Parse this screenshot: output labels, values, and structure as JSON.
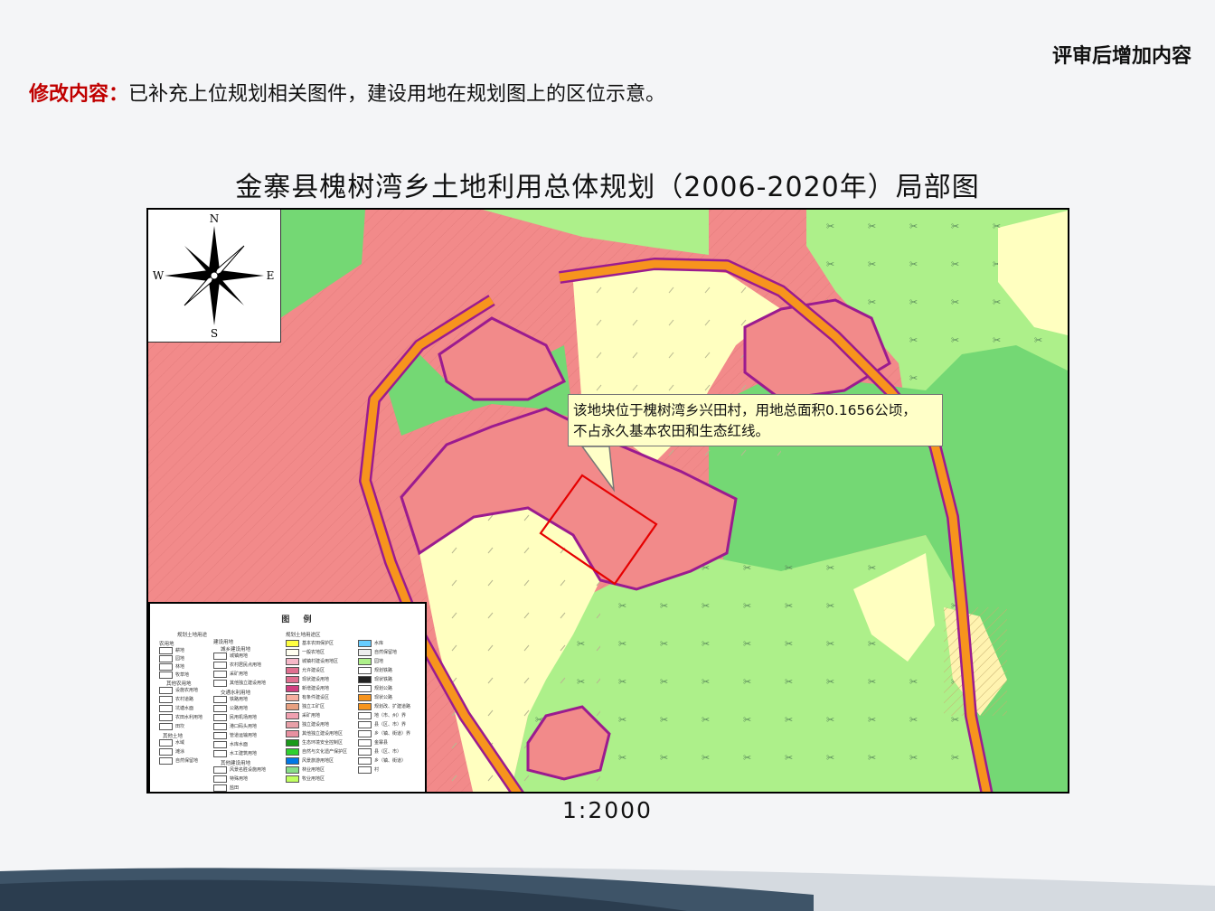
{
  "header": {
    "tag": "评审后增加内容",
    "note_label": "修改内容：",
    "note_text": "已补充上位规划相关图件，建设用地在规划图上的区位示意。"
  },
  "map": {
    "title": "金寨县槐树湾乡土地利用总体规划（2006-2020年）局部图",
    "scale": "1:2000",
    "callout_line1": "该地块位于槐树湾乡兴田村，用地总面积0.1656公顷，",
    "callout_line2": "不占永久基本农田和生态红线。",
    "compass": {
      "n": "N",
      "s": "S",
      "e": "E",
      "w": "W"
    },
    "colors": {
      "construction": "#f28a8a",
      "forest": "#74d874",
      "garden": "#adf08a",
      "farmland": "#ffffc0",
      "road": "#f7941d",
      "boundary": "#9b1b8f",
      "site": "#e60000"
    }
  },
  "legend": {
    "title": "图 例",
    "col1_header": "规划土地用途",
    "col1_sub1": "农用地",
    "col1_items": [
      "耕地",
      "园地",
      "林地",
      "牧草地"
    ],
    "col1_sub2": "其他农用地",
    "col1_items2": [
      "设施农用地",
      "农村道路",
      "坑塘水面",
      "农田水利用地",
      "田坎"
    ],
    "col1_sub3": "其他土地",
    "col1_items3": [
      "水域",
      "滩涂",
      "自然保留地"
    ],
    "col2_sub1": "建设用地",
    "col2_sub1b": "城乡建设用地",
    "col2_items": [
      "城镇用地",
      "农村居民点用地",
      "采矿用地",
      "其他独立建设用地"
    ],
    "col2_sub2": "交通水利用地",
    "col2_items2": [
      "铁路用地",
      "公路用地",
      "民用机场用地",
      "港口码头用地",
      "管道运输用地",
      "水库水面",
      "水工建筑用地"
    ],
    "col2_sub3": "其他建设用地",
    "col2_items3": [
      "风景名胜设施用地",
      "特殊用地",
      "盐田"
    ],
    "col3_header": "规划土地用途区",
    "col3_items": [
      "基本农田保护区",
      "一般农地区",
      "城镇村建设用地区",
      "允许建设区",
      "现状建设用地",
      "新增建设用地",
      "有条件建设区",
      "独立工矿区",
      "采矿用地",
      "独立建设用地",
      "其他独立建设用地区",
      "生态环境安全控制区",
      "自然与文化遗产保护区",
      "风景旅游用地区",
      "林业用地区",
      "牧业用地区"
    ],
    "col4_items": [
      "水库",
      "自然保留地",
      "园地",
      "规划铁路",
      "现状铁路",
      "规划公路",
      "现状公路",
      "规划改、扩建道路",
      "地（市、州）界",
      "县（区、市）界",
      "乡（镇、街道）界",
      "金寨县",
      "县（区、市）",
      "乡（镇、街道）",
      "村"
    ]
  }
}
